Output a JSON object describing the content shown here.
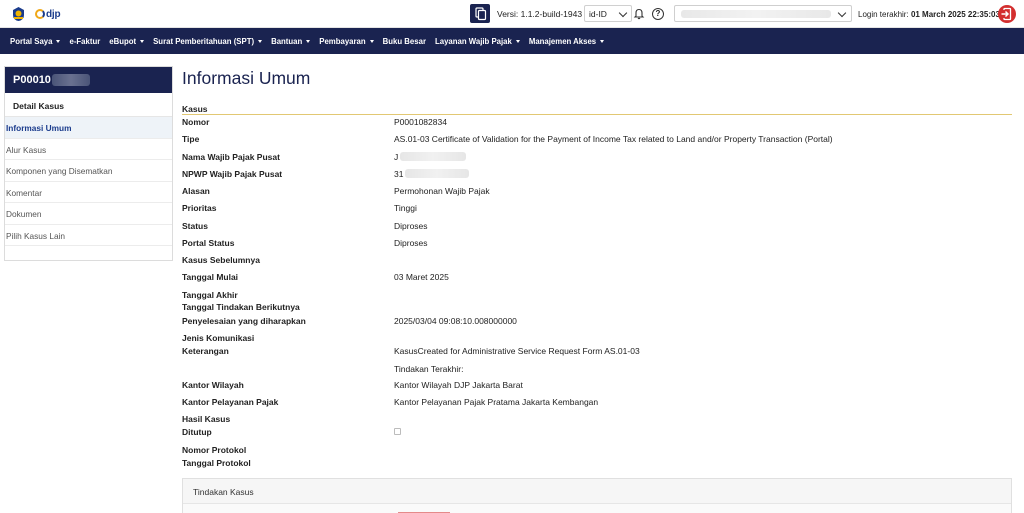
{
  "topbar": {
    "logo_text": "djp",
    "version_label": "Versi:  1.1.2-build-1943",
    "language": "id-ID",
    "login_label": "Login terakhir:",
    "login_value": "01 March 2025 22:35:03",
    "icons": [
      "kemenkeu-logo",
      "djp-logo",
      "copy-icon",
      "bell-icon",
      "help-icon",
      "logout-icon"
    ]
  },
  "nav": {
    "items": [
      {
        "label": "Portal Saya",
        "dropdown": true
      },
      {
        "label": "e-Faktur",
        "dropdown": false
      },
      {
        "label": "eBupot",
        "dropdown": true
      },
      {
        "label": "Surat Pemberitahuan (SPT)",
        "dropdown": true
      },
      {
        "label": "Bantuan",
        "dropdown": true
      },
      {
        "label": "Pembayaran",
        "dropdown": true
      },
      {
        "label": "Buku Besar",
        "dropdown": false
      },
      {
        "label": "Layanan Wajib Pajak",
        "dropdown": true
      },
      {
        "label": "Manajemen Akses",
        "dropdown": true
      }
    ]
  },
  "sidebar": {
    "case_id": "P00010",
    "title": "Detail Kasus",
    "items": [
      {
        "label": "Informasi Umum",
        "active": true
      },
      {
        "label": "Alur Kasus",
        "active": false
      },
      {
        "label": "Komponen yang Disematkan",
        "active": false
      },
      {
        "label": "Komentar",
        "active": false
      },
      {
        "label": "Dokumen",
        "active": false
      },
      {
        "label": "Pilih Kasus Lain",
        "active": false
      }
    ]
  },
  "main": {
    "title": "Informasi Umum",
    "section": "Kasus",
    "fields": {
      "nomor": {
        "label": "Nomor",
        "value": "P0001082834"
      },
      "tipe": {
        "label": "Tipe",
        "value": "AS.01-03 Certificate of Validation for the Payment of Income Tax related to Land and/or Property Transaction (Portal)"
      },
      "nama_wp": {
        "label": "Nama Wajib Pajak Pusat",
        "value": "J"
      },
      "npwp": {
        "label": "NPWP Wajib Pajak Pusat",
        "value": "31"
      },
      "alasan": {
        "label": "Alasan",
        "value": "Permohonan Wajib Pajak"
      },
      "prioritas": {
        "label": "Prioritas",
        "value": "Tinggi"
      },
      "status": {
        "label": "Status",
        "value": "Diproses"
      },
      "portal_status": {
        "label": "Portal Status",
        "value": "Diproses"
      },
      "kasus_sebelumnya": {
        "label": "Kasus Sebelumnya",
        "value": ""
      },
      "tanggal_mulai": {
        "label": "Tanggal Mulai",
        "value": "03 Maret 2025"
      },
      "tanggal_akhir": {
        "label": "Tanggal Akhir",
        "value": ""
      },
      "tanggal_tindakan": {
        "label": "Tanggal Tindakan Berikutnya",
        "value": ""
      },
      "penyelesaian": {
        "label": "Penyelesaian yang diharapkan",
        "value": "2025/03/04 09:08:10.008000000"
      },
      "jenis_komunikasi": {
        "label": "Jenis Komunikasi",
        "value": ""
      },
      "keterangan": {
        "label": "Keterangan",
        "value": "KasusCreated for Administrative Service Request Form AS.01-03"
      },
      "keterangan_2": {
        "value": "Tindakan Terakhir:"
      },
      "kantor_wilayah": {
        "label": "Kantor Wilayah",
        "value": "Kantor Wilayah DJP Jakarta Barat"
      },
      "kantor_pelayanan": {
        "label": "Kantor Pelayanan Pajak",
        "value": "Kantor Pelayanan Pajak Pratama Jakarta Kembangan"
      },
      "hasil_kasus": {
        "label": "Hasil Kasus",
        "value": ""
      },
      "ditutup": {
        "label": "Ditutup",
        "checked": false
      },
      "nomor_protokol": {
        "label": "Nomor Protokol",
        "value": ""
      },
      "tanggal_protokol": {
        "label": "Tanggal Protokol",
        "value": ""
      }
    },
    "tindakan_panel_title": "Tindakan Kasus"
  },
  "colors": {
    "navy": "#1a2350",
    "accent_gold": "#e2c873",
    "logout_red": "#d32f2f"
  }
}
